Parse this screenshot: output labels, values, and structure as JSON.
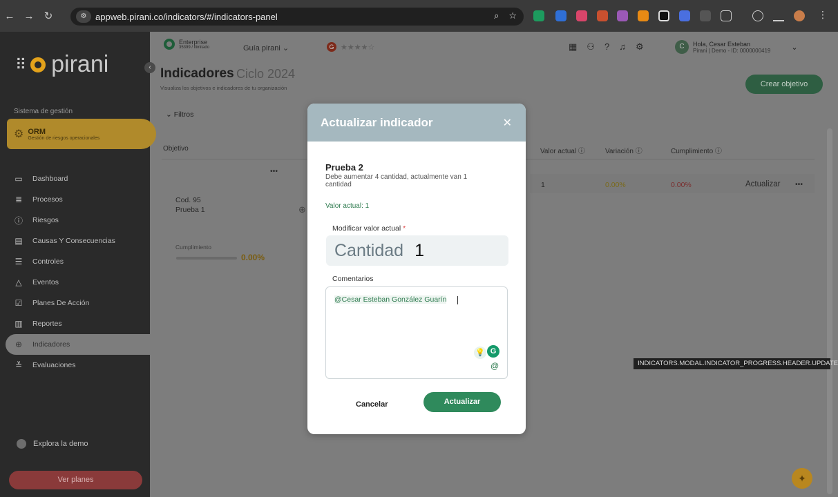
{
  "browser": {
    "url": "appweb.pirani.co/indicators/#/indicators-panel"
  },
  "sidebar": {
    "brand": "pirani",
    "section_label": "Sistema de gestión",
    "module": {
      "title": "ORM",
      "subtitle": "Gestión de riesgos operacionales"
    },
    "items": [
      {
        "label": "Dashboard",
        "icon": "monitor-icon"
      },
      {
        "label": "Procesos",
        "icon": "process-icon"
      },
      {
        "label": "Riesgos",
        "icon": "alert-circle-icon"
      },
      {
        "label": "Causas Y Consecuencias",
        "icon": "archive-icon"
      },
      {
        "label": "Controles",
        "icon": "sliders-icon"
      },
      {
        "label": "Eventos",
        "icon": "warning-icon"
      },
      {
        "label": "Planes De Acción",
        "icon": "checkbox-icon"
      },
      {
        "label": "Reportes",
        "icon": "chart-icon"
      },
      {
        "label": "Indicadores",
        "icon": "target-icon",
        "active": true
      },
      {
        "label": "Evaluaciones",
        "icon": "evaluation-icon"
      }
    ],
    "explore": "Explora la demo",
    "plans_button": "Ver planes"
  },
  "header": {
    "plan_name": "Enterprise",
    "plan_detail": "35399 / Ilimitado",
    "guide": "Guía pirani",
    "rating": "★★★★☆",
    "user_greeting": "Hola, Cesar Esteban",
    "user_detail": "Pirani | Demo - ID: 0000000419"
  },
  "page": {
    "title": "Indicadores",
    "cycle": "Ciclo 2024",
    "subtitle": "Visualiza los objetivos e indicadores de tu organización",
    "create_button": "Crear objetivo",
    "filters": "Filtros"
  },
  "table": {
    "columns": {
      "objective": "Objetivo",
      "current_value": "Valor actual",
      "variation": "Variación",
      "fulfillment": "Cumplimiento"
    },
    "row": {
      "code": "Cod. 95",
      "name": "Prueba 1",
      "fulfillment_label": "Cumplimiento",
      "fulfillment_value": "0.00%",
      "current_value": "1",
      "variation": "0.00%",
      "fulfillment": "0.00%",
      "action": "Actualizar"
    }
  },
  "tooltip": "INDICATORS.MODAL.INDICATOR_PROGRESS.HEADER.UPDATE",
  "modal": {
    "title": "Actualizar indicador",
    "indicator_name": "Prueba 2",
    "description": "Debe aumentar 4 cantidad, actualmente van 1 cantidad",
    "current_value_text": "Valor actual: 1",
    "modify_label": "Modificar valor actual",
    "required_mark": "*",
    "quantity_label": "Cantidad",
    "quantity_value": "1",
    "comments_label": "Comentarios",
    "mention": "@Cesar Esteban González Guarín",
    "cancel": "Cancelar",
    "submit": "Actualizar"
  }
}
